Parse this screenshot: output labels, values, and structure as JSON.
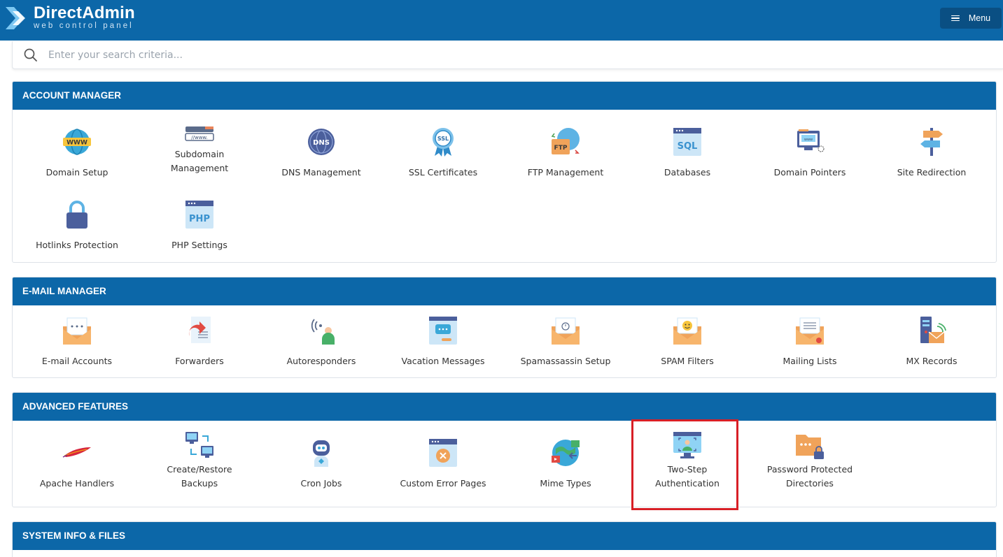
{
  "app": {
    "brand_title": "DirectAdmin",
    "brand_subtitle": "web control panel",
    "menu_label": "Menu"
  },
  "search": {
    "placeholder": "Enter your search criteria..."
  },
  "sections": [
    {
      "title": "ACCOUNT MANAGER",
      "items": [
        {
          "label": "Domain Setup",
          "icon": "www-globe-icon"
        },
        {
          "label": "Subdomain Management",
          "icon": "subdomain-icon"
        },
        {
          "label": "DNS Management",
          "icon": "dns-globe-icon"
        },
        {
          "label": "SSL Certificates",
          "icon": "ssl-badge-icon"
        },
        {
          "label": "FTP Management",
          "icon": "ftp-icon"
        },
        {
          "label": "Databases",
          "icon": "sql-database-icon"
        },
        {
          "label": "Domain Pointers",
          "icon": "domain-pointer-icon"
        },
        {
          "label": "Site Redirection",
          "icon": "signpost-icon"
        },
        {
          "label": "Hotlinks Protection",
          "icon": "lock-icon"
        },
        {
          "label": "PHP Settings",
          "icon": "php-icon"
        }
      ]
    },
    {
      "title": "E-MAIL MANAGER",
      "items": [
        {
          "label": "E-mail Accounts",
          "icon": "email-envelope-icon"
        },
        {
          "label": "Forwarders",
          "icon": "forward-icon"
        },
        {
          "label": "Autoresponders",
          "icon": "autoresponder-icon"
        },
        {
          "label": "Vacation Messages",
          "icon": "vacation-message-icon"
        },
        {
          "label": "Spamassassin Setup",
          "icon": "spamassassin-icon"
        },
        {
          "label": "SPAM Filters",
          "icon": "spam-filter-icon"
        },
        {
          "label": "Mailing Lists",
          "icon": "mailing-list-icon"
        },
        {
          "label": "MX Records",
          "icon": "mx-records-icon"
        }
      ]
    },
    {
      "title": "ADVANCED FEATURES",
      "items": [
        {
          "label": "Apache Handlers",
          "icon": "apache-feather-icon"
        },
        {
          "label": "Create/Restore Backups",
          "icon": "backup-icon"
        },
        {
          "label": "Cron Jobs",
          "icon": "robot-icon"
        },
        {
          "label": "Custom Error Pages",
          "icon": "error-page-icon"
        },
        {
          "label": "Mime Types",
          "icon": "mime-types-icon"
        },
        {
          "label": "Two-Step Authentication",
          "icon": "two-step-auth-icon"
        },
        {
          "label": "Password Protected Directories",
          "icon": "protected-folder-icon"
        }
      ]
    },
    {
      "title": "SYSTEM INFO & FILES",
      "items": []
    }
  ],
  "colors": {
    "header_blue": "#0c67a8",
    "menu_button": "#0a4f83",
    "highlight_red": "#d81f26"
  }
}
